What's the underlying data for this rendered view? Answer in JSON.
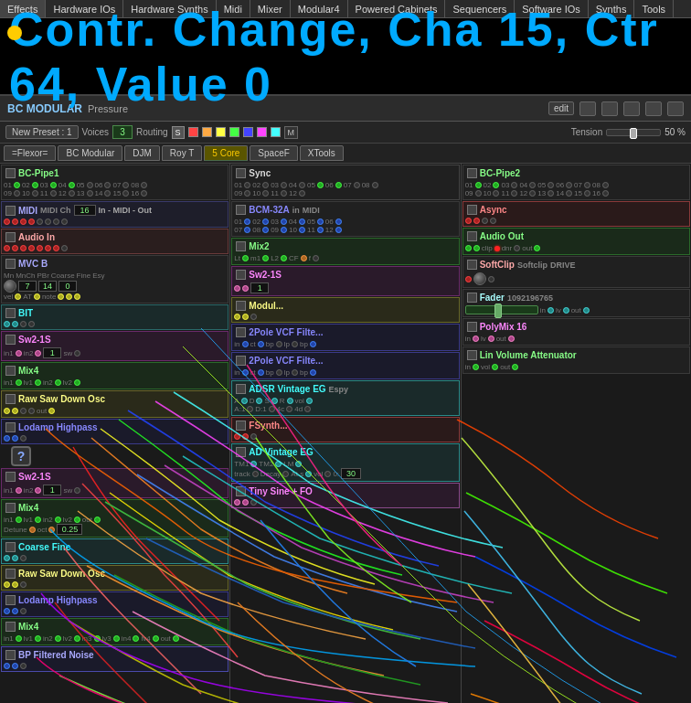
{
  "menu": {
    "items": [
      {
        "label": "Effects",
        "active": false
      },
      {
        "label": "Hardware IOs",
        "active": false
      },
      {
        "label": "Hardware Synths",
        "active": false
      },
      {
        "label": "Midi",
        "active": false
      },
      {
        "label": "Mixer",
        "active": false
      },
      {
        "label": "Modular4",
        "active": false
      },
      {
        "label": "Powered Cabinets",
        "active": false
      },
      {
        "label": "Sequencers",
        "active": false
      },
      {
        "label": "Software IOs",
        "active": false
      },
      {
        "label": "Synths",
        "active": false
      },
      {
        "label": "Tools",
        "active": false
      }
    ]
  },
  "notification": {
    "text": "Contr. Change, Cha 15, Ctr 64, Value 0"
  },
  "bc_header": {
    "title": "BC MODULAR",
    "subtitle": "Pressure",
    "edit_label": "edit"
  },
  "toolbar": {
    "new_preset_label": "New Preset : 1",
    "voices_label": "Voices",
    "voices_value": "3",
    "routing_label": "Routing",
    "routing_s": "S",
    "routing_m": "M",
    "tension_label": "Tension",
    "tension_value": "50 %",
    "colors": [
      "#ff4444",
      "#ffaa44",
      "#ffff44",
      "#44ff44",
      "#4444ff",
      "#ff44ff",
      "#44ffff"
    ]
  },
  "flexor_tabs": {
    "tabs": [
      {
        "label": "=Flexor=",
        "active": false
      },
      {
        "label": "BC Modular",
        "active": false
      },
      {
        "label": "DJM",
        "active": false
      },
      {
        "label": "Roy T",
        "active": false
      },
      {
        "label": "5 Core",
        "active": true,
        "highlighted": true
      },
      {
        "label": "SpaceF",
        "active": false
      },
      {
        "label": "XTools",
        "active": false
      }
    ]
  },
  "left_col": {
    "modules": [
      {
        "name": "BC-Pipe1",
        "type": "bcpipe",
        "color": "green",
        "ports_top": [
          "01",
          "02",
          "03",
          "04",
          "05",
          "06",
          "07",
          "08"
        ],
        "ports_bot": [
          "09",
          "10",
          "11",
          "12",
          "13",
          "14",
          "15",
          "16"
        ]
      },
      {
        "name": "MIDI",
        "sub": "MIDI Ch",
        "value": "16",
        "type": "midi"
      },
      {
        "name": "Audio In",
        "type": "audio"
      },
      {
        "name": "MVC B",
        "type": "mvc",
        "params": [
          "Mn",
          "MnCh",
          "PBr",
          "Coarse",
          "Fine",
          "Esy"
        ]
      },
      {
        "name": "BIT",
        "type": "bit"
      },
      {
        "name": "Sw2-1S",
        "type": "sw"
      },
      {
        "name": "Mix4",
        "type": "mix"
      },
      {
        "name": "Raw Saw Down Osc",
        "type": "osc"
      },
      {
        "name": "Lodamp Highpass",
        "type": "filter"
      },
      {
        "name": "Sw2-1S",
        "type": "sw"
      },
      {
        "name": "Mix4",
        "type": "mix"
      },
      {
        "name": "Coarse Fine",
        "type": "coarsefine"
      },
      {
        "name": "Raw Saw Down Osc",
        "type": "osc"
      },
      {
        "name": "Lodamp Highpass",
        "type": "filter"
      },
      {
        "name": "Mix4",
        "type": "mix"
      },
      {
        "name": "BP Filtered Noise",
        "type": "noise"
      }
    ]
  },
  "mid_col": {
    "modules": [
      {
        "name": "Sync",
        "type": "sync"
      },
      {
        "name": "BCM-32A",
        "type": "bcm"
      },
      {
        "name": "Mix2",
        "type": "mix"
      },
      {
        "name": "Sw2-1S",
        "type": "sw"
      },
      {
        "name": "Modul...",
        "type": "mod"
      },
      {
        "name": "2Pole VCF Filte...",
        "type": "filter"
      },
      {
        "name": "2Pole VCF Filte...",
        "type": "filter"
      },
      {
        "name": "ADSR Vintage EG",
        "type": "eg"
      },
      {
        "name": "FSynth...",
        "type": "synth"
      },
      {
        "name": "AD Vintage EG",
        "type": "eg"
      },
      {
        "name": "Tiny Sine + FO",
        "type": "osc"
      }
    ]
  },
  "right_col": {
    "modules": [
      {
        "name": "BC-Pipe2",
        "type": "bcpipe",
        "color": "green"
      },
      {
        "name": "Async",
        "type": "async"
      },
      {
        "name": "Audio Out",
        "type": "audio"
      },
      {
        "name": "SoftClip",
        "type": "softclip",
        "params": [
          "Softclip",
          "DRIVE"
        ]
      },
      {
        "name": "Fader",
        "type": "fader",
        "value": "1092196765"
      },
      {
        "name": "PolyMix 16",
        "type": "polymix"
      },
      {
        "name": "Lin Volume Attenuator",
        "type": "linvol"
      }
    ]
  },
  "wires": {
    "description": "Complex multicolor wire routing across all modules"
  }
}
